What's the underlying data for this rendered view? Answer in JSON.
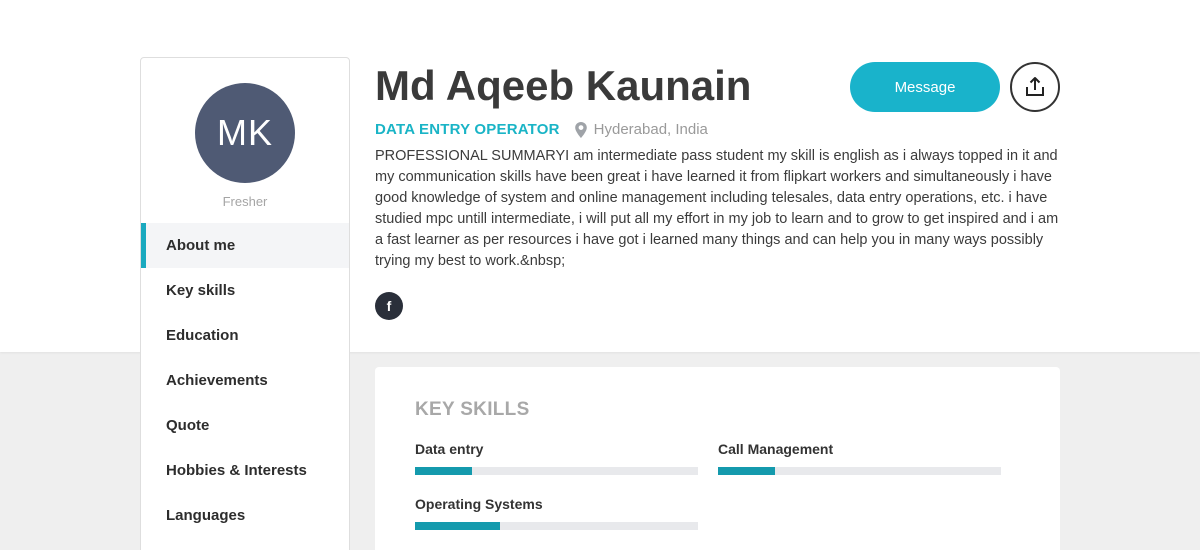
{
  "profile": {
    "initials": "MK",
    "experience": "Fresher",
    "name": "Md Aqeeb Kaunain",
    "role": "DATA ENTRY OPERATOR",
    "location": "Hyderabad, India",
    "summary": "PROFESSIONAL SUMMARYI am intermediate pass student my skill is english as i always topped in it and my communication skills have been great i have learned it from flipkart workers and simultaneously i have good knowledge of system and online management including telesales, data entry operations, etc. i have studied mpc untill intermediate, i will put all my effort in my job to learn and to grow to get inspired and i am a fast learner as per resources i have got i learned many things and can help you in many ways possibly trying my best to work.&nbsp;",
    "social": {
      "facebook_glyph": "f"
    }
  },
  "actions": {
    "message_label": "Message"
  },
  "nav": {
    "items": [
      {
        "label": "About me",
        "active": true
      },
      {
        "label": "Key skills",
        "active": false
      },
      {
        "label": "Education",
        "active": false
      },
      {
        "label": "Achievements",
        "active": false
      },
      {
        "label": "Quote",
        "active": false
      },
      {
        "label": "Hobbies & Interests",
        "active": false
      },
      {
        "label": "Languages",
        "active": false
      }
    ]
  },
  "skills_card": {
    "title": "KEY SKILLS",
    "skills": [
      {
        "label": "Data entry",
        "level": 0.2
      },
      {
        "label": "Call Management",
        "level": 0.2
      },
      {
        "label": "Operating Systems",
        "level": 0.3
      }
    ]
  },
  "colors": {
    "accent": "#19b3cb",
    "avatar_bg": "#4f5a74",
    "bar_fill": "#149aad"
  }
}
